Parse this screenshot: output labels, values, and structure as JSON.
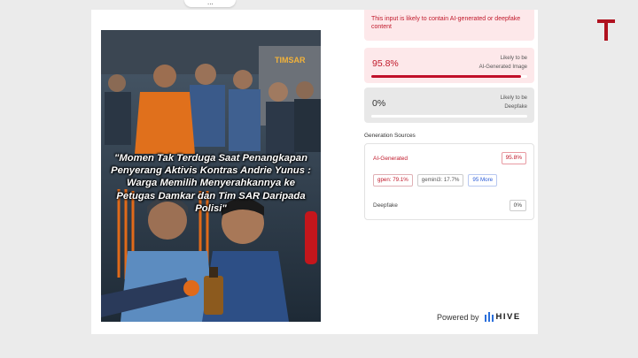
{
  "top_pill": {
    "text": "..."
  },
  "image_caption": "\"Momen Tak Terduga Saat Penangkapan Penyerang Aktivis Kontras Andrie Yunus : Warga Memilih Menyerahkannya ke Petugas Damkar dan Tim SAR Daripada Polisi\"",
  "image_truck_text": "TIMSAR",
  "warning": {
    "text": "This input is likely to contain AI-generated or deepfake content"
  },
  "ai_generated": {
    "percent": "95.8%",
    "label": "Likely to be\nAI-Generated Image",
    "value": 0.958
  },
  "deepfake": {
    "percent": "0%",
    "label": "Likely to be\nDeepfake",
    "value": 0
  },
  "generation_sources": {
    "title": "Generation Sources",
    "ai_label": "AI-Generated",
    "ai_value": "95.8%",
    "chips": [
      "gpen: 79.1%",
      "gemini3: 17.7%",
      "95 More"
    ],
    "deepfake_label": "Deepfake",
    "deepfake_value": "0%"
  },
  "footer": {
    "powered_by": "Powered by",
    "brand": "HIVE"
  },
  "colors": {
    "accent": "#c0182a",
    "pink_bg": "#fde8ea",
    "gray_bg": "#e8e8e8",
    "link": "#2a5bd7",
    "t_logo": "#b0121f"
  }
}
